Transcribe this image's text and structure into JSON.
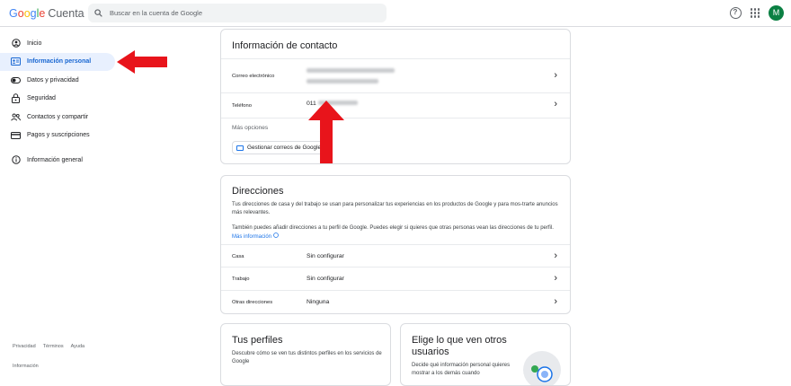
{
  "app": {
    "logo_word": "Google",
    "product": "Cuenta",
    "search_placeholder": "Buscar en la cuenta de Google",
    "avatar_letter": "M",
    "help_glyph": "?"
  },
  "nav": {
    "items": [
      {
        "label": "Inicio",
        "icon": "home-icon",
        "active": false
      },
      {
        "label": "Información personal",
        "icon": "id-card-icon",
        "active": true
      },
      {
        "label": "Datos y privacidad",
        "icon": "toggle-icon",
        "active": false
      },
      {
        "label": "Seguridad",
        "icon": "lock-icon",
        "active": false
      },
      {
        "label": "Contactos y compartir",
        "icon": "people-icon",
        "active": false
      },
      {
        "label": "Pagos y suscripciones",
        "icon": "credit-card-icon",
        "active": false
      },
      {
        "label": "Información general",
        "icon": "info-icon",
        "active": false
      }
    ],
    "footer": {
      "privacy": "Privacidad",
      "terms": "Términos",
      "help": "Ayuda",
      "info": "Información"
    }
  },
  "contact": {
    "title": "Información de contacto",
    "email_label": "Correo electrónico",
    "phone_label": "Teléfono",
    "phone_prefix": "011",
    "more_options": "Más opciones",
    "manage_button": "Gestionar correos de Google"
  },
  "addresses": {
    "title": "Direcciones",
    "description": "Tus direcciones de casa y del trabajo se usan para personalizar tus experiencias en los productos de Google y para mos-trarte anuncios más relevantes.",
    "note": "También puedes añadir direcciones a tu perfil de Google. Puedes elegir si quieres que otras personas vean las direcciones de tu perfil.",
    "more_info_link": "Más información",
    "rows": [
      {
        "label": "Casa",
        "value": "Sin configurar"
      },
      {
        "label": "Trabajo",
        "value": "Sin configurar"
      },
      {
        "label": "Otras direcciones",
        "value": "Ninguna"
      }
    ]
  },
  "profiles": {
    "title": "Tus perfiles",
    "description": "Descubre cómo se ven tus distintos perfiles en los servicios de Google"
  },
  "visibility": {
    "title": "Elige lo que ven otros usuarios",
    "description": "Decide qué información personal quieres mostrar a los demás cuando"
  },
  "colors": {
    "accent": "#1a73e8",
    "active_bg": "#e8f0fe",
    "arrow": "#e8141b",
    "avatar": "#0b8043"
  }
}
